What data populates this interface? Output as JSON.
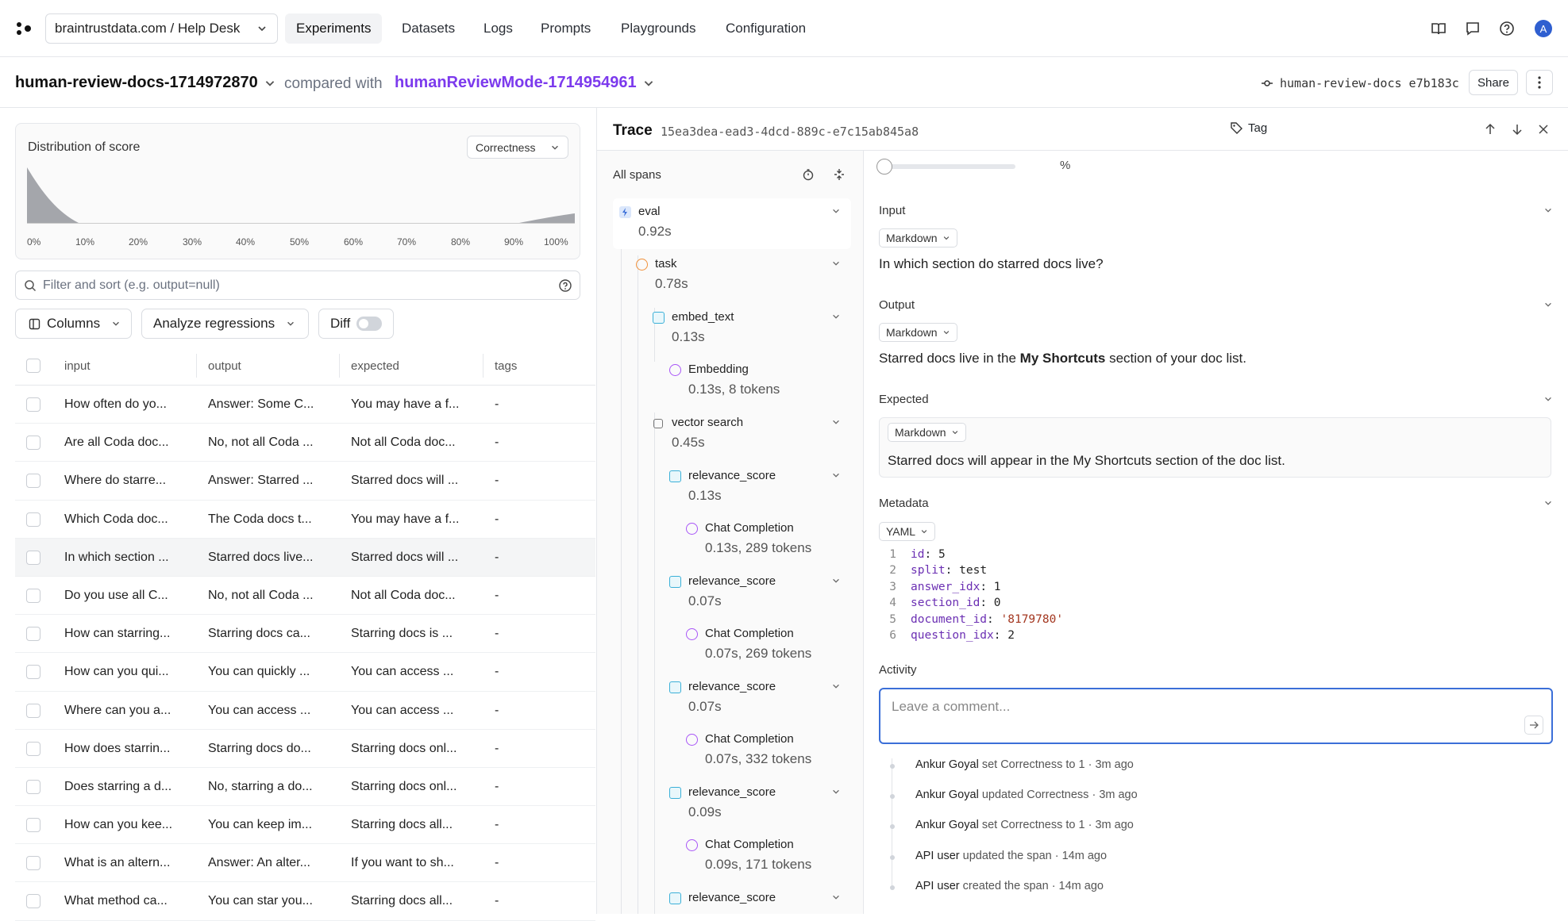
{
  "nav": {
    "project": "braintrustdata.com / Help Desk",
    "items": [
      "Experiments",
      "Datasets",
      "Logs",
      "Prompts",
      "Playgrounds",
      "Configuration"
    ],
    "active": "Experiments",
    "avatar": "A"
  },
  "header": {
    "experiment": "human-review-docs-1714972870",
    "compared_with": "compared with",
    "compare_experiment": "humanReviewMode-1714954961",
    "commit": "human-review-docs e7b183c",
    "share": "Share"
  },
  "distribution": {
    "title": "Distribution of score",
    "selector": "Correctness",
    "ticks": [
      "0%",
      "10%",
      "20%",
      "30%",
      "40%",
      "50%",
      "60%",
      "70%",
      "80%",
      "90%",
      "100%"
    ]
  },
  "filter": {
    "placeholder": "Filter and sort (e.g. output=null)"
  },
  "toolbar": {
    "columns": "Columns",
    "analyze": "Analyze regressions",
    "diff": "Diff"
  },
  "table": {
    "headers": [
      "input",
      "output",
      "expected",
      "tags"
    ],
    "rows": [
      [
        "How often do yo...",
        "Answer: Some C...",
        "You may have a f...",
        "-"
      ],
      [
        "Are all Coda doc...",
        "No, not all Coda ...",
        "Not all Coda doc...",
        "-"
      ],
      [
        "Where do starre...",
        "Answer: Starred ...",
        "Starred docs will ...",
        "-"
      ],
      [
        "Which Coda doc...",
        "The Coda docs t...",
        "You may have a f...",
        "-"
      ],
      [
        "In which section ...",
        "Starred docs live...",
        "Starred docs will ...",
        "-"
      ],
      [
        "Do you use all C...",
        "No, not all Coda ...",
        "Not all Coda doc...",
        "-"
      ],
      [
        "How can starring...",
        "Starring docs ca...",
        "Starring docs is ...",
        "-"
      ],
      [
        "How can you qui...",
        "You can quickly ...",
        "You can access ...",
        "-"
      ],
      [
        "Where can you a...",
        "You can access ...",
        "You can access ...",
        "-"
      ],
      [
        "How does starrin...",
        "Starring docs do...",
        "Starring docs onl...",
        "-"
      ],
      [
        "Does starring a d...",
        "No, starring a do...",
        "Starring docs onl...",
        "-"
      ],
      [
        "How can you kee...",
        "You can keep im...",
        "Starring docs all...",
        "-"
      ],
      [
        "What is an altern...",
        "Answer: An alter...",
        "If you want to sh...",
        "-"
      ],
      [
        "What method ca...",
        "You can star you...",
        "Starring docs all...",
        "-"
      ]
    ],
    "selected_row": 4
  },
  "trace": {
    "title": "Trace",
    "id": "15ea3dea-ead3-4dcd-889c-e7c15ab845a8",
    "tag": "Tag",
    "all_spans": "All spans",
    "spans": [
      {
        "name": "eval",
        "detail": "0.92s",
        "kind": "eval"
      },
      {
        "name": "task",
        "detail": "0.78s",
        "kind": "task"
      },
      {
        "name": "embed_text",
        "detail": "0.13s",
        "kind": "func"
      },
      {
        "name": "Embedding",
        "detail": "0.13s, 8 tokens",
        "kind": "llm"
      },
      {
        "name": "vector search",
        "detail": "0.45s",
        "kind": "box"
      },
      {
        "name": "relevance_score",
        "detail": "0.13s",
        "kind": "func"
      },
      {
        "name": "Chat Completion",
        "detail": "0.13s, 289 tokens",
        "kind": "llm"
      },
      {
        "name": "relevance_score",
        "detail": "0.07s",
        "kind": "func"
      },
      {
        "name": "Chat Completion",
        "detail": "0.07s, 269 tokens",
        "kind": "llm"
      },
      {
        "name": "relevance_score",
        "detail": "0.07s",
        "kind": "func"
      },
      {
        "name": "Chat Completion",
        "detail": "0.07s, 332 tokens",
        "kind": "llm"
      },
      {
        "name": "relevance_score",
        "detail": "0.09s",
        "kind": "func"
      },
      {
        "name": "Chat Completion",
        "detail": "0.09s, 171 tokens",
        "kind": "llm"
      },
      {
        "name": "relevance_score",
        "detail": "",
        "kind": "func"
      }
    ]
  },
  "detail": {
    "percent": "%",
    "input_label": "Input",
    "input_format": "Markdown",
    "input_text": "In which section do starred docs live?",
    "output_label": "Output",
    "output_format": "Markdown",
    "output_pre": "Starred docs live in the ",
    "output_bold": "My Shortcuts",
    "output_post": " section of your doc list.",
    "expected_label": "Expected",
    "expected_format": "Markdown",
    "expected_text": "Starred docs will appear in the My Shortcuts section of the doc list.",
    "metadata_label": "Metadata",
    "metadata_format": "YAML",
    "metadata": [
      {
        "key": "id",
        "value": "5"
      },
      {
        "key": "split",
        "value": "test"
      },
      {
        "key": "answer_idx",
        "value": "1"
      },
      {
        "key": "section_id",
        "value": "0"
      },
      {
        "key": "document_id",
        "value": "'8179780'"
      },
      {
        "key": "question_idx",
        "value": "2"
      }
    ],
    "activity_label": "Activity",
    "comment_placeholder": "Leave a comment...",
    "activity": [
      {
        "user": "Ankur Goyal",
        "text": "set Correctness to 1 · 3m ago"
      },
      {
        "user": "Ankur Goyal",
        "text": "updated Correctness · 3m ago"
      },
      {
        "user": "Ankur Goyal",
        "text": "set Correctness to 1 · 3m ago"
      },
      {
        "user": "API user",
        "text": "updated the span · 14m ago"
      },
      {
        "user": "API user",
        "text": "created the span · 14m ago"
      }
    ]
  }
}
